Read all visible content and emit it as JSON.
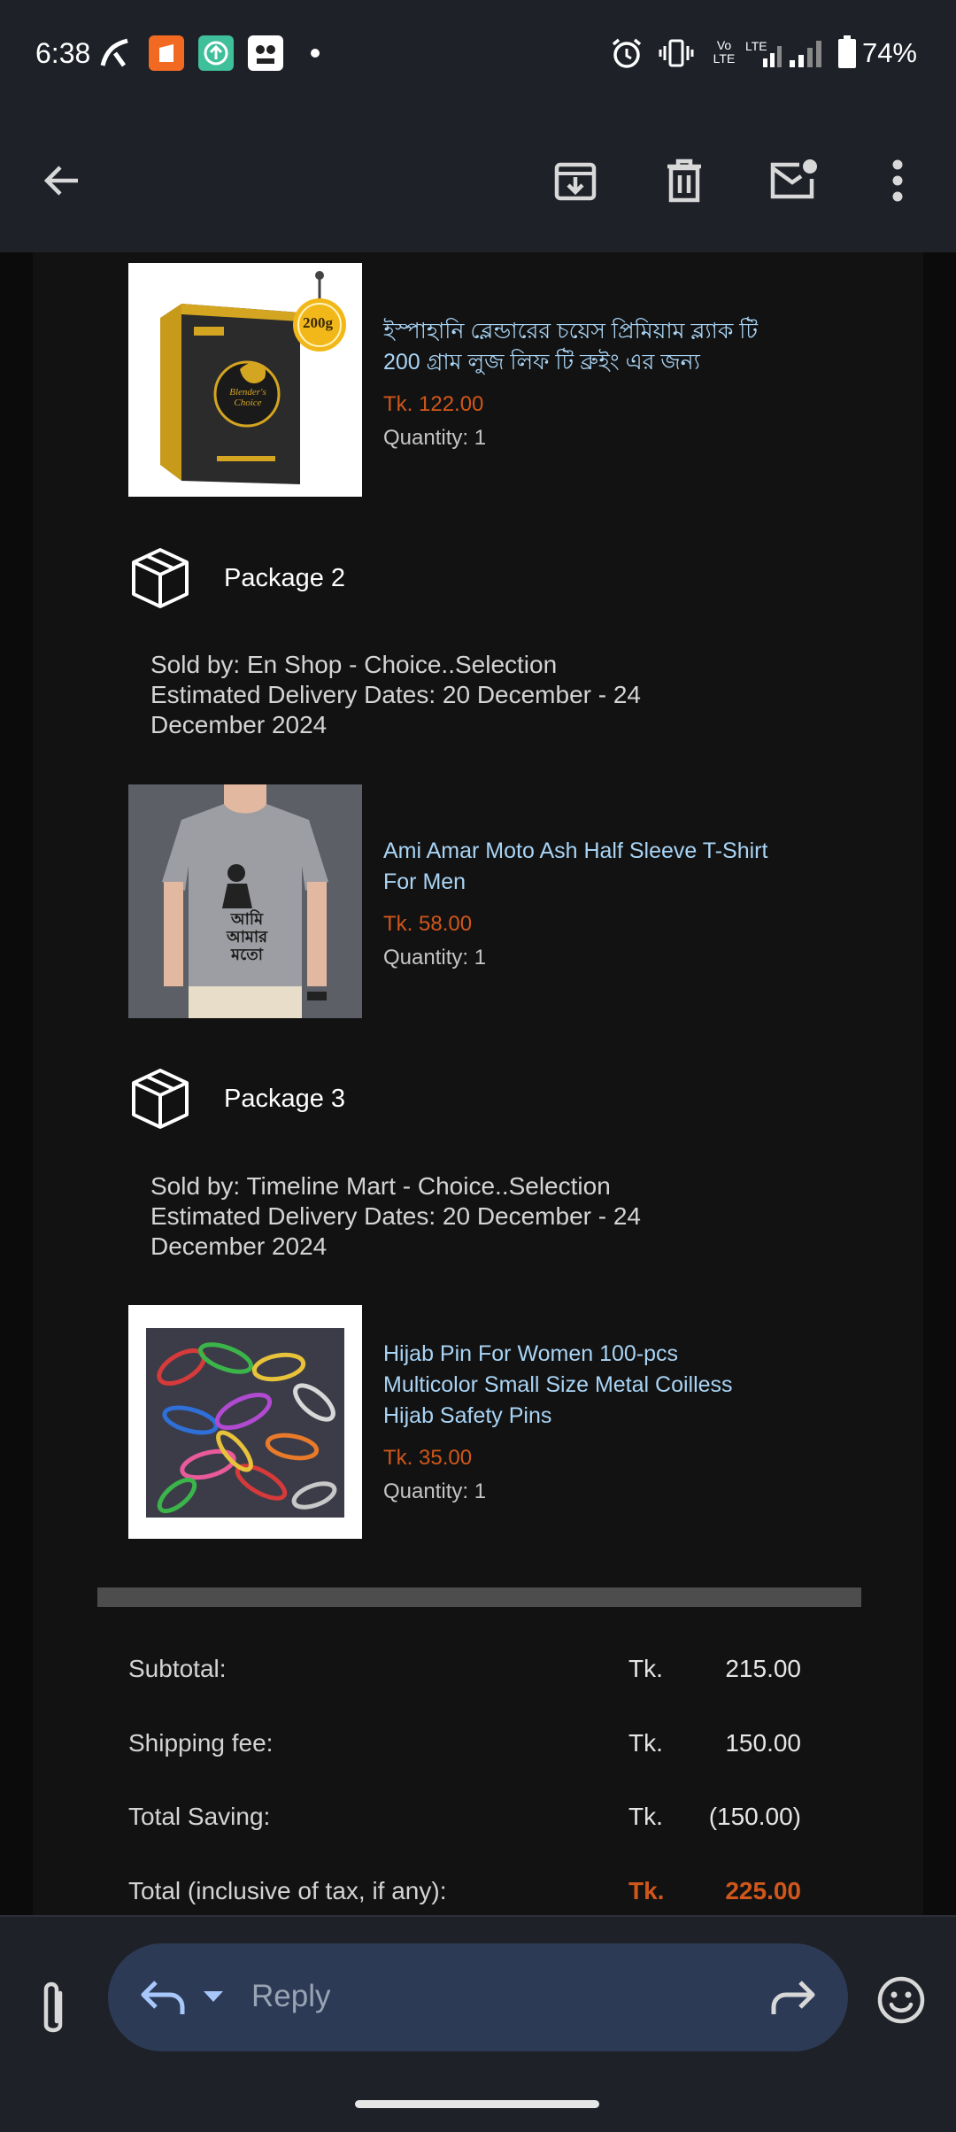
{
  "status_bar": {
    "time": "6:38",
    "network_label": "Vo LTE",
    "lte_label": "LTE",
    "battery": "74%"
  },
  "toolbar": {
    "icons": [
      "back-arrow-icon",
      "archive-icon",
      "delete-icon",
      "mark-unread-icon",
      "more-options-icon"
    ]
  },
  "products": [
    {
      "title": "ইস্পাহানি ব্লেন্ডারের চয়েস প্রিমিয়াম ব্ল্যাক টি 200 গ্রাম লুজ লিফ টি ব্রুইং এর জন্য",
      "price": "Tk. 122.00",
      "quantity": "Quantity: 1",
      "image_badge": "200g",
      "image_brand": "Blender's Choice"
    },
    {
      "title": "Ami Amar Moto Ash Half Sleeve T-Shirt For Men",
      "price": "Tk. 58.00",
      "quantity": "Quantity: 1",
      "image_print": "আমি আমার মতো"
    },
    {
      "title": "Hijab Pin For Women 100-pcs Multicolor Small Size Metal Coilless Hijab Safety Pins",
      "price": "Tk. 35.00",
      "quantity": "Quantity: 1"
    }
  ],
  "packages": [
    {
      "label": "Package 2",
      "sold_by": "Sold by: En Shop - Choice..Selection",
      "delivery": "Estimated Delivery Dates: 20 December - 24 December 2024"
    },
    {
      "label": "Package 3",
      "sold_by": "Sold by: Timeline Mart - Choice..Selection",
      "delivery": "Estimated Delivery Dates: 20 December - 24 December 2024"
    }
  ],
  "summary": {
    "subtotal": {
      "label": "Subtotal:",
      "currency": "Tk.",
      "value": "215.00"
    },
    "shipping": {
      "label": "Shipping fee:",
      "currency": "Tk.",
      "value": "150.00"
    },
    "saving": {
      "label": "Total Saving:",
      "currency": "Tk.",
      "value": "(150.00)"
    },
    "total": {
      "label": "Total (inclusive of tax, if any):",
      "currency": "Tk.",
      "value": "225.00"
    }
  },
  "reply_bar": {
    "placeholder": "Reply"
  },
  "colors": {
    "price": "#d0571a",
    "link": "#a9d4f5",
    "toolbar_bg": "#1e2128",
    "reply_pill": "#2c3a55"
  }
}
